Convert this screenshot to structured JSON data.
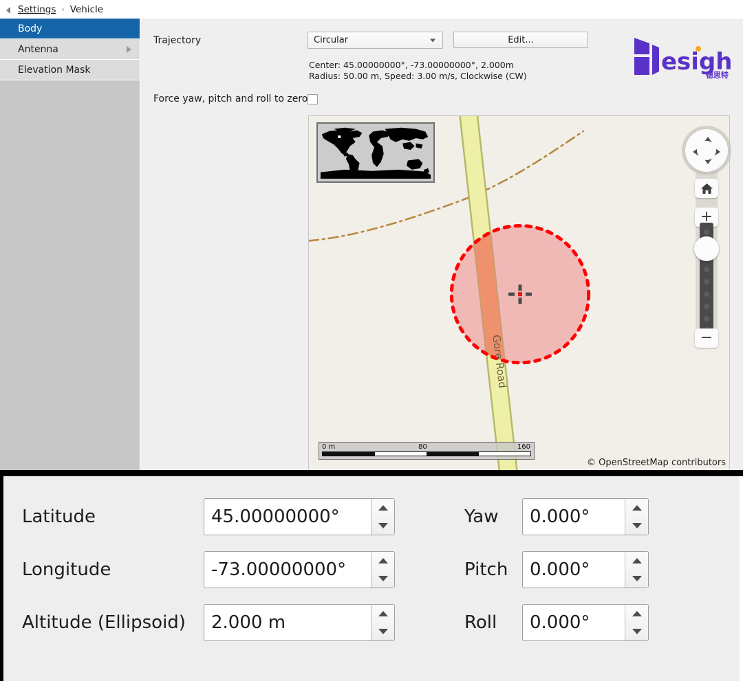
{
  "breadcrumb": {
    "back_icon": "back-triangle-icon",
    "root": "Settings",
    "separator": "›",
    "current": "Vehicle"
  },
  "sidebar": {
    "items": [
      {
        "label": "Body",
        "selected": true,
        "has_submenu": false
      },
      {
        "label": "Antenna",
        "selected": false,
        "has_submenu": true
      },
      {
        "label": "Elevation Mask",
        "selected": false,
        "has_submenu": false
      }
    ],
    "selected_color": "#1565a8",
    "item_color": "#dcdcdc",
    "background": "#c7c7c7"
  },
  "content": {
    "trajectory_label": "Trajectory",
    "trajectory_value": "Circular",
    "trajectory_caret": "chevron-down-icon",
    "edit_button": "Edit...",
    "summary_line1": "Center: 45.00000000°, -73.00000000°, 2.000m",
    "summary_line2": "Radius: 50.00 m, Speed: 3.00 m/s, Clockwise (CW)",
    "force_label": "Force yaw, pitch and roll to zero",
    "force_checked": false,
    "logo_text": "esight",
    "logo_sub": "德思特",
    "logo_color": "#5b32c8",
    "logo_dot_color": "#f5a623"
  },
  "map": {
    "minimap_name": "world-overview-minimap",
    "road_label": "Gore Road",
    "road_color": "#eff0a8",
    "road_outline": "#b5b96a",
    "highlight_color": "#f5b97c",
    "background": "#f2efe9",
    "trajectory_circle_color": "#ff0000",
    "trajectory_fill": "rgba(237,120,120,0.45)",
    "boundary_color": "#b8893f",
    "scale": {
      "start": "0 m",
      "middle": "80",
      "end": "160"
    },
    "attribution": "© OpenStreetMap contributors",
    "controls": {
      "pan": "pan-compass",
      "home": "home-icon",
      "zoom_in": "+",
      "zoom_out": "−"
    }
  },
  "form": {
    "left": [
      {
        "label": "Latitude",
        "value": "45.00000000°"
      },
      {
        "label": "Longitude",
        "value": "-73.00000000°"
      },
      {
        "label": "Altitude (Ellipsoid)",
        "value": "2.000 m"
      }
    ],
    "right": [
      {
        "label": "Yaw",
        "value": "0.000°"
      },
      {
        "label": "Pitch",
        "value": "0.000°"
      },
      {
        "label": "Roll",
        "value": "0.000°"
      }
    ]
  }
}
